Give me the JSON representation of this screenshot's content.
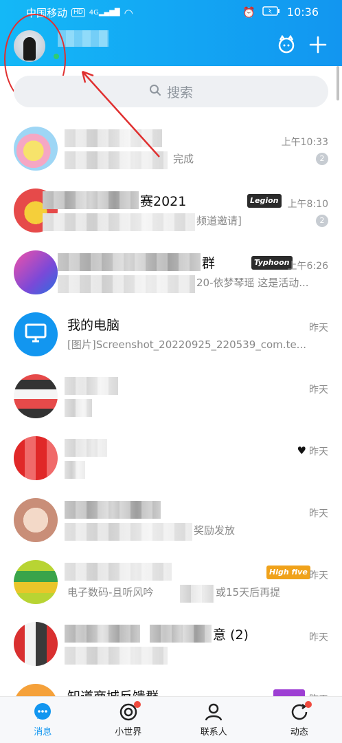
{
  "status_bar": {
    "carrier": "中国移动",
    "hd": "HD",
    "signal": "4G",
    "time": "10:36"
  },
  "header": {
    "avatar_icon": "user-avatar",
    "pet_icon": "pet-icon",
    "add_icon": "plus-icon"
  },
  "search": {
    "placeholder": "搜索",
    "icon": "search-icon"
  },
  "conversations": [
    {
      "title": "",
      "preview": "完成",
      "time": "上午10:33",
      "badge": "2"
    },
    {
      "title": "赛2021",
      "preview": "频道邀请]",
      "time": "上午8:10",
      "badge": "2",
      "tag": "Legion"
    },
    {
      "title": "群",
      "preview": "20-依梦琴瑶 这是活动...",
      "time": "上午6:26",
      "tag": "Typhoon"
    },
    {
      "title": "我的电脑",
      "preview": "[图片]Screenshot_20220925_220539_com.te...",
      "time": "昨天"
    },
    {
      "title": "",
      "preview": "",
      "time": "昨天"
    },
    {
      "title": "",
      "preview": "",
      "time": "昨天"
    },
    {
      "title": "",
      "preview": "奖励发放",
      "time": "昨天"
    },
    {
      "title": "",
      "preview": "电子数码-且听风吟",
      "preview2": "或15天后再提",
      "time": "昨天",
      "tag": "High five"
    },
    {
      "title": "意 (2)",
      "preview": "",
      "time": "昨天"
    },
    {
      "title": "知道商城反馈群",
      "preview": "",
      "time": "昨天"
    }
  ],
  "bottom_nav": [
    {
      "label": "消息",
      "icon": "message-icon",
      "active": true
    },
    {
      "label": "小世界",
      "icon": "world-icon",
      "dot": true
    },
    {
      "label": "联系人",
      "icon": "contacts-icon"
    },
    {
      "label": "动态",
      "icon": "activity-icon",
      "dot": true
    }
  ],
  "colors": {
    "accent": "#1296f0",
    "header_start": "#14b8f7",
    "annotation": "#e03030"
  }
}
